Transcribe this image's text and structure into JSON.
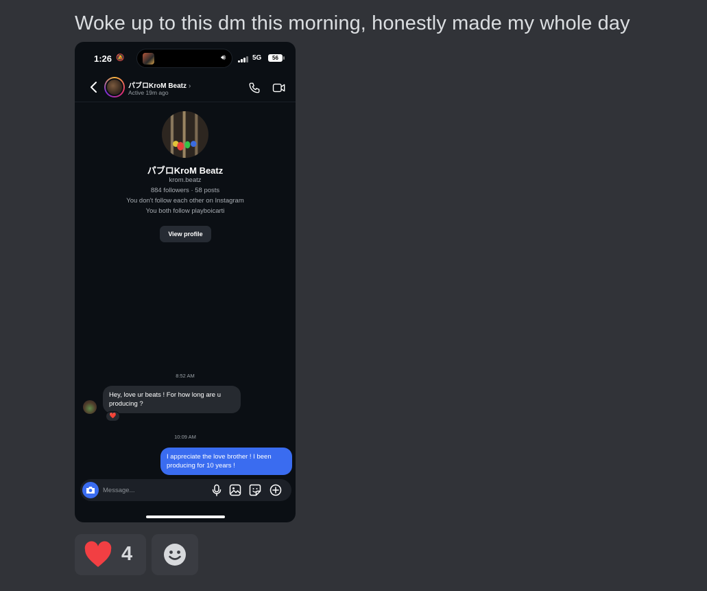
{
  "post": {
    "caption": "Woke up to this dm this morning, honestly made my whole day"
  },
  "phone": {
    "status_bar": {
      "time": "1:26",
      "network": "5G",
      "battery": "56"
    },
    "header": {
      "name": "パブロKroM Beatz",
      "status": "Active 19m ago"
    },
    "profile": {
      "name": "パブロKroM Beatz",
      "username": "krom.beatz",
      "stats": "884 followers · 58 posts",
      "follow_status": "You don't follow each other on Instagram",
      "mutual": "You both follow playboicarti",
      "view_profile_label": "View profile"
    },
    "messages": [
      {
        "time": "8:52 AM",
        "direction": "incoming",
        "text": "Hey, love ur beats ! For how long are u producing ?",
        "reaction": "❤️"
      },
      {
        "time": "10:09 AM",
        "direction": "outgoing",
        "text": "I appreciate the love brother ! I been producing for 10 years !"
      }
    ],
    "composer": {
      "placeholder": "Message..."
    }
  },
  "reactions": {
    "heart_count": "4",
    "heart_color": "#f23f43"
  },
  "colors": {
    "background": "#313338",
    "outgoing_bubble": "#3a6cf0",
    "incoming_bubble": "#262a30",
    "phone_bg": "#0b0f14"
  }
}
